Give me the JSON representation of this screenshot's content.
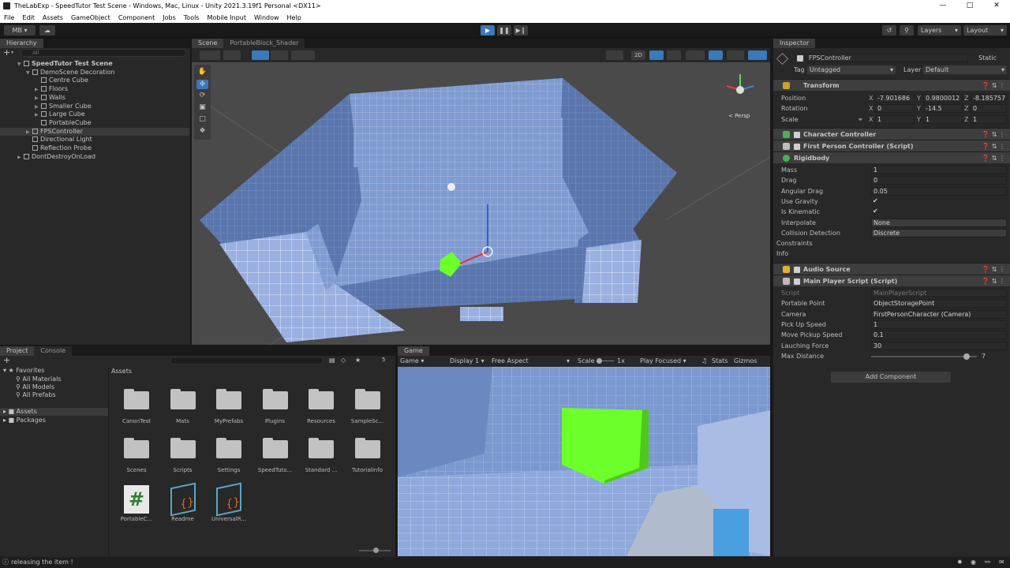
{
  "window": {
    "title": "TheLabExp - SpeedTutor Test Scene - Windows, Mac, Linux - Unity 2021.3.19f1 Personal <DX11>"
  },
  "menu": [
    "File",
    "Edit",
    "Assets",
    "GameObject",
    "Component",
    "Jobs",
    "Tools",
    "Mobile Input",
    "Window",
    "Help"
  ],
  "toolbar": {
    "account": "MB",
    "layers": "Layers",
    "layout": "Layout"
  },
  "hierarchy": {
    "tab": "Hierarchy",
    "search_placeholder": "All",
    "items": [
      {
        "label": "SpeedTutor Test Scene",
        "indent": 0,
        "bold": true,
        "expanded": true
      },
      {
        "label": "DemoScene Decoration",
        "indent": 1,
        "expanded": true
      },
      {
        "label": "Centre Cube",
        "indent": 2
      },
      {
        "label": "Floors",
        "indent": 2,
        "collapsed": true
      },
      {
        "label": "Walls",
        "indent": 2,
        "collapsed": true
      },
      {
        "label": "Smaller Cube",
        "indent": 2,
        "collapsed": true
      },
      {
        "label": "Large Cube",
        "indent": 2,
        "collapsed": true
      },
      {
        "label": "PortableCube",
        "indent": 2
      },
      {
        "label": "FPSController",
        "indent": 1,
        "collapsed": true,
        "selected": true
      },
      {
        "label": "Directional Light",
        "indent": 1
      },
      {
        "label": "Reflection Probe",
        "indent": 1
      },
      {
        "label": "DontDestroyOnLoad",
        "indent": 0,
        "collapsed": true
      }
    ]
  },
  "scene": {
    "tabs": [
      "Scene",
      "PortableBlock_Shader"
    ],
    "view_2d": "2D",
    "persp": "< Persp"
  },
  "game": {
    "tab": "Game",
    "bar": {
      "mode": "Game",
      "display": "Display 1",
      "aspect": "Free Aspect",
      "scale_label": "Scale",
      "scale_value": "1x",
      "play_mode": "Play Focused",
      "stats": "Stats",
      "gizmos": "Gizmos"
    }
  },
  "project": {
    "tabs": [
      "Project",
      "Console"
    ],
    "favorites": {
      "title": "Favorites",
      "items": [
        "All Materials",
        "All Models",
        "All Prefabs"
      ]
    },
    "roots": [
      "Assets",
      "Packages"
    ],
    "breadcrumb": "Assets",
    "hidden_count": "5",
    "assets": [
      "CanonTest",
      "Mats",
      "MyPrefabs",
      "Plugins",
      "Resources",
      "SampleSc...",
      "Scenes",
      "Scripts",
      "Settings",
      "SpeedTuto...",
      "Standard ...",
      "TutorialInfo",
      "PortableC...",
      "Readme",
      "UniversalR..."
    ]
  },
  "inspector": {
    "tab": "Inspector",
    "object_name": "FPSController",
    "static_label": "Static",
    "tag_label": "Tag",
    "tag_value": "Untagged",
    "layer_label": "Layer",
    "layer_value": "Default",
    "transform": {
      "title": "Transform",
      "position": {
        "label": "Position",
        "x": "-7.901686",
        "y": "0.9800012",
        "z": "-8.185757"
      },
      "rotation": {
        "label": "Rotation",
        "x": "0",
        "y": "-14.5",
        "z": "0"
      },
      "scale": {
        "label": "Scale",
        "x": "1",
        "y": "1",
        "z": "1"
      }
    },
    "components": [
      "Character Controller",
      "First Person Controller (Script)",
      "Rigidbody"
    ],
    "rigidbody": [
      {
        "label": "Mass",
        "value": "1"
      },
      {
        "label": "Drag",
        "value": "0"
      },
      {
        "label": "Angular Drag",
        "value": "0.05"
      },
      {
        "label": "Use Gravity",
        "value": "✔"
      },
      {
        "label": "Is Kinematic",
        "value": "✔"
      },
      {
        "label": "Interpolate",
        "value": "None"
      },
      {
        "label": "Collision Detection",
        "value": "Discrete"
      },
      {
        "label": "Constraints",
        "value": ""
      },
      {
        "label": "Info",
        "value": ""
      }
    ],
    "audio_source": "Audio Source",
    "main_player": {
      "title": "Main Player Script (Script)",
      "fields": [
        {
          "label": "Script",
          "value": "MainPlayerScript"
        },
        {
          "label": "Portable Point",
          "value": "ObjectStoragePoint"
        },
        {
          "label": "Camera",
          "value": "FirstPersonCharacter (Camera)"
        },
        {
          "label": "Pick Up Speed",
          "value": "1"
        },
        {
          "label": "Move Pickup Speed",
          "value": "0.1"
        },
        {
          "label": "Lauching Force",
          "value": "30"
        },
        {
          "label": "Max Distance",
          "value": "7"
        }
      ],
      "max_distance_fraction": 0.9
    },
    "add_component": "Add Component"
  },
  "status": {
    "message": "releasing the item !"
  },
  "colors": {
    "accent": "#3a79bb",
    "green": "#7dff2e",
    "wall": "#8aa6d6"
  }
}
